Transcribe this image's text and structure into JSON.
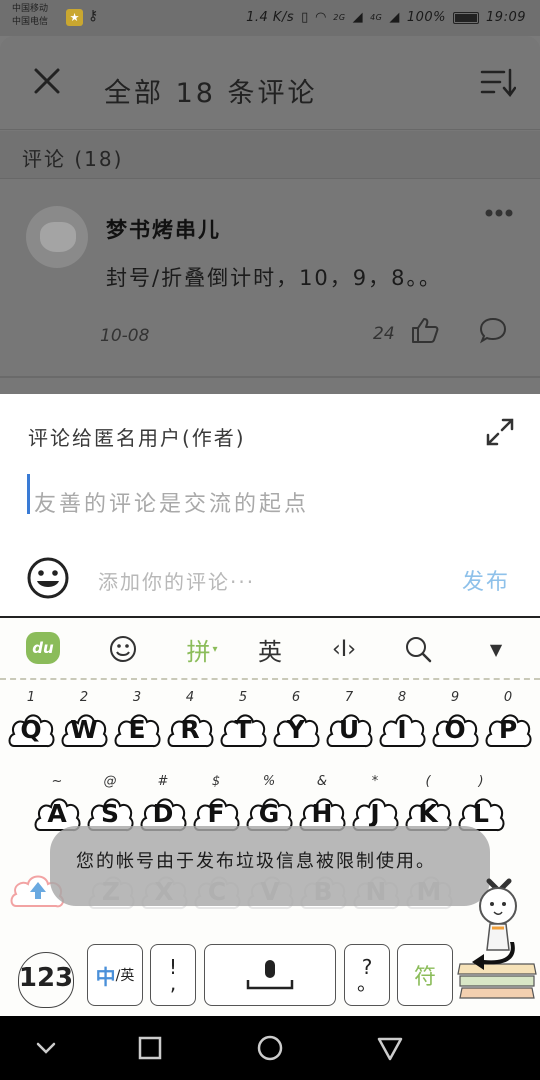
{
  "status_bar": {
    "carrier_1": "中国移动",
    "carrier_2": "中国电信",
    "network_speed": "1.4 K/s",
    "signal_1": "2G",
    "signal_2": "4G",
    "battery": "100%",
    "time": "19:09"
  },
  "sheet": {
    "title": "全部 18 条评论",
    "section_label": "评论 (18)",
    "comment": {
      "username": "梦书烤串儿",
      "text": "封号/折叠倒计时，10，9，8。。",
      "date": "10-08",
      "likes": "24"
    }
  },
  "input_panel": {
    "reply_to": "评论给匿名用户(作者)",
    "placeholder": "友善的评论是交流的起点",
    "add_comment": "添加你的评论···",
    "publish": "发布"
  },
  "keyboard": {
    "toolbar": {
      "logo": "du",
      "pinyin": "拼",
      "english": "英",
      "cursor": "‹I›"
    },
    "row1": [
      {
        "key": "Q",
        "sub": "1"
      },
      {
        "key": "W",
        "sub": "2"
      },
      {
        "key": "E",
        "sub": "3"
      },
      {
        "key": "R",
        "sub": "4"
      },
      {
        "key": "T",
        "sub": "5"
      },
      {
        "key": "Y",
        "sub": "6"
      },
      {
        "key": "U",
        "sub": "7"
      },
      {
        "key": "I",
        "sub": "8"
      },
      {
        "key": "O",
        "sub": "9"
      },
      {
        "key": "P",
        "sub": "0"
      }
    ],
    "row2": [
      {
        "key": "A",
        "sub": "~"
      },
      {
        "key": "S",
        "sub": "@"
      },
      {
        "key": "D",
        "sub": "#"
      },
      {
        "key": "F",
        "sub": "$"
      },
      {
        "key": "G",
        "sub": "%"
      },
      {
        "key": "H",
        "sub": "&"
      },
      {
        "key": "J",
        "sub": "*"
      },
      {
        "key": "K",
        "sub": "("
      },
      {
        "key": "L",
        "sub": ")"
      }
    ],
    "row3": [
      {
        "key": "Z"
      },
      {
        "key": "X"
      },
      {
        "key": "C"
      },
      {
        "key": "V"
      },
      {
        "key": "B"
      },
      {
        "key": "N"
      },
      {
        "key": "M"
      }
    ],
    "toast": "您的帐号由于发布垃圾信息被限制使用。",
    "bottom": {
      "numbers": "123",
      "lang_cn": "中",
      "lang_sep": "/英",
      "punct1_top": "!",
      "punct1_bottom": ",",
      "punct2_top": "?",
      "punct2_bottom": "。",
      "symbol": "符"
    }
  },
  "colors": {
    "accent_green": "#8bbc5a",
    "publish_blue": "#8ec1ea",
    "cursor_blue": "#3a7bd5"
  }
}
